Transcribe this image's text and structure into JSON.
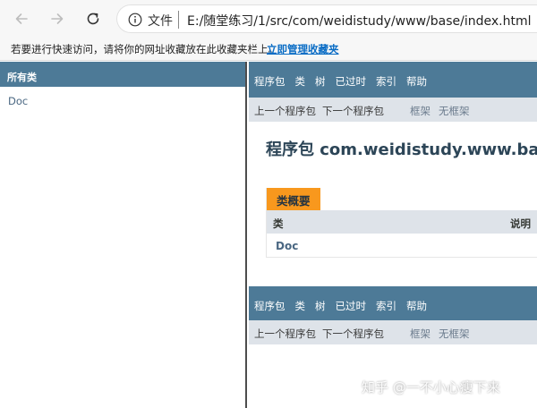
{
  "browser": {
    "protocol_label": "文件",
    "url": "E:/随堂练习/1/src/com/weidistudy/www/base/index.html"
  },
  "favorites_bar": {
    "hint": "若要进行快速访问，请将你的网址收藏放在此收藏夹栏上。",
    "manage_link": "立即管理收藏夹"
  },
  "left_frame": {
    "header": "所有类",
    "items": [
      "Doc"
    ]
  },
  "right_frame": {
    "top_nav": [
      "程序包",
      "类",
      "树",
      "已过时",
      "索引",
      "帮助"
    ],
    "sub_nav": {
      "prev_package": "上一个程序包",
      "next_package": "下一个程序包",
      "frames": "框架",
      "no_frames": "无框架"
    },
    "package_title": "程序包 com.weidistudy.www.base",
    "class_summary": {
      "caption": "类概要",
      "columns": [
        "类",
        "说明"
      ],
      "rows": [
        {
          "class": "Doc",
          "description": ""
        }
      ]
    },
    "bottom_nav": [
      "程序包",
      "类",
      "树",
      "已过时",
      "索引",
      "帮助"
    ],
    "bottom_sub_nav": {
      "prev_package": "上一个程序包",
      "next_package": "下一个程序包",
      "frames": "框架",
      "no_frames": "无框架"
    }
  },
  "watermark": "知乎 @一不小心瘦下来",
  "colors": {
    "nav_bg": "#4d7a97",
    "subnav_bg": "#dee3e9",
    "caption_bg": "#f8981d",
    "link": "#4a6782"
  }
}
